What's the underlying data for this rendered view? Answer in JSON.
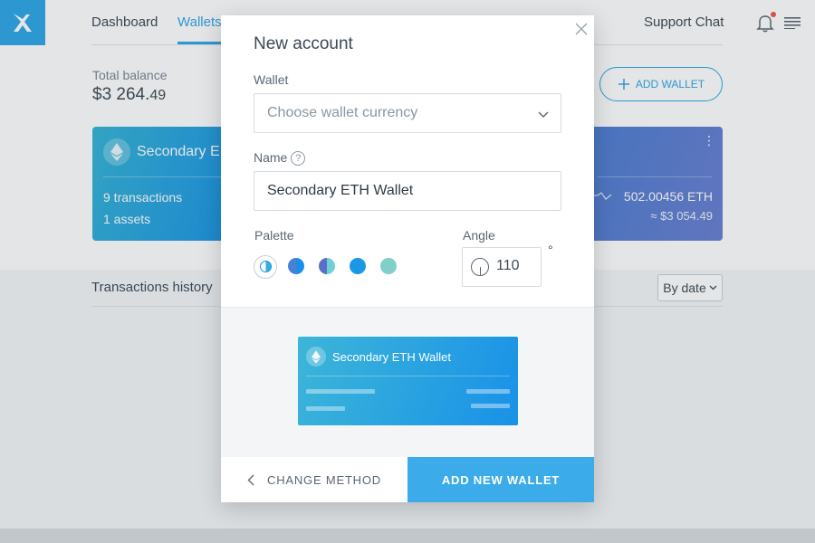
{
  "nav": {
    "items": [
      {
        "label": "Dashboard",
        "active": false
      },
      {
        "label": "Wallets",
        "active": true
      }
    ],
    "support_label": "Support Chat",
    "icons": {
      "logo": "x-logo-icon",
      "bell": "bell-icon",
      "menu": "menu-icon"
    },
    "notification_dot": true
  },
  "balance": {
    "label": "Total balance",
    "value_main": "$3 264.",
    "value_cents": "49"
  },
  "add_wallet_label": "ADD WALLET",
  "wallet_cards": [
    {
      "name": "Secondary E",
      "transactions": "9 transactions",
      "assets": "1 assets"
    },
    {
      "amount": "502.00456 ETH",
      "fiat": "≈ $3 054.49"
    }
  ],
  "transactions": {
    "label": "Transactions history",
    "sort_label": "By date"
  },
  "modal": {
    "title": "New account",
    "wallet": {
      "label": "Wallet",
      "placeholder": "Choose wallet currency"
    },
    "name": {
      "label": "Name",
      "help_glyph": "?",
      "value": "Secondary ETH Wallet"
    },
    "palette": {
      "label": "Palette",
      "selected_index": 0,
      "swatches": [
        {
          "colors": [
            "#35b0dc",
            "#1a8fe6"
          ]
        },
        {
          "colors": [
            "#4a7fd3",
            "#1a8fe6"
          ]
        },
        {
          "colors": [
            "#5b6fc8",
            "#6fd0d3"
          ]
        },
        {
          "colors": [
            "#1a98e6",
            "#1a98e6"
          ]
        },
        {
          "colors": [
            "#7fd0c8",
            "#7fd0c8"
          ]
        }
      ]
    },
    "angle": {
      "label": "Angle",
      "value": "110",
      "unit": "°"
    },
    "preview": {
      "name": "Secondary ETH Wallet"
    },
    "buttons": {
      "change_method": "CHANGE METHOD",
      "add_new_wallet": "ADD NEW WALLET"
    }
  },
  "colors": {
    "accent": "#2ea6e8",
    "primary_button": "#3bace9"
  }
}
